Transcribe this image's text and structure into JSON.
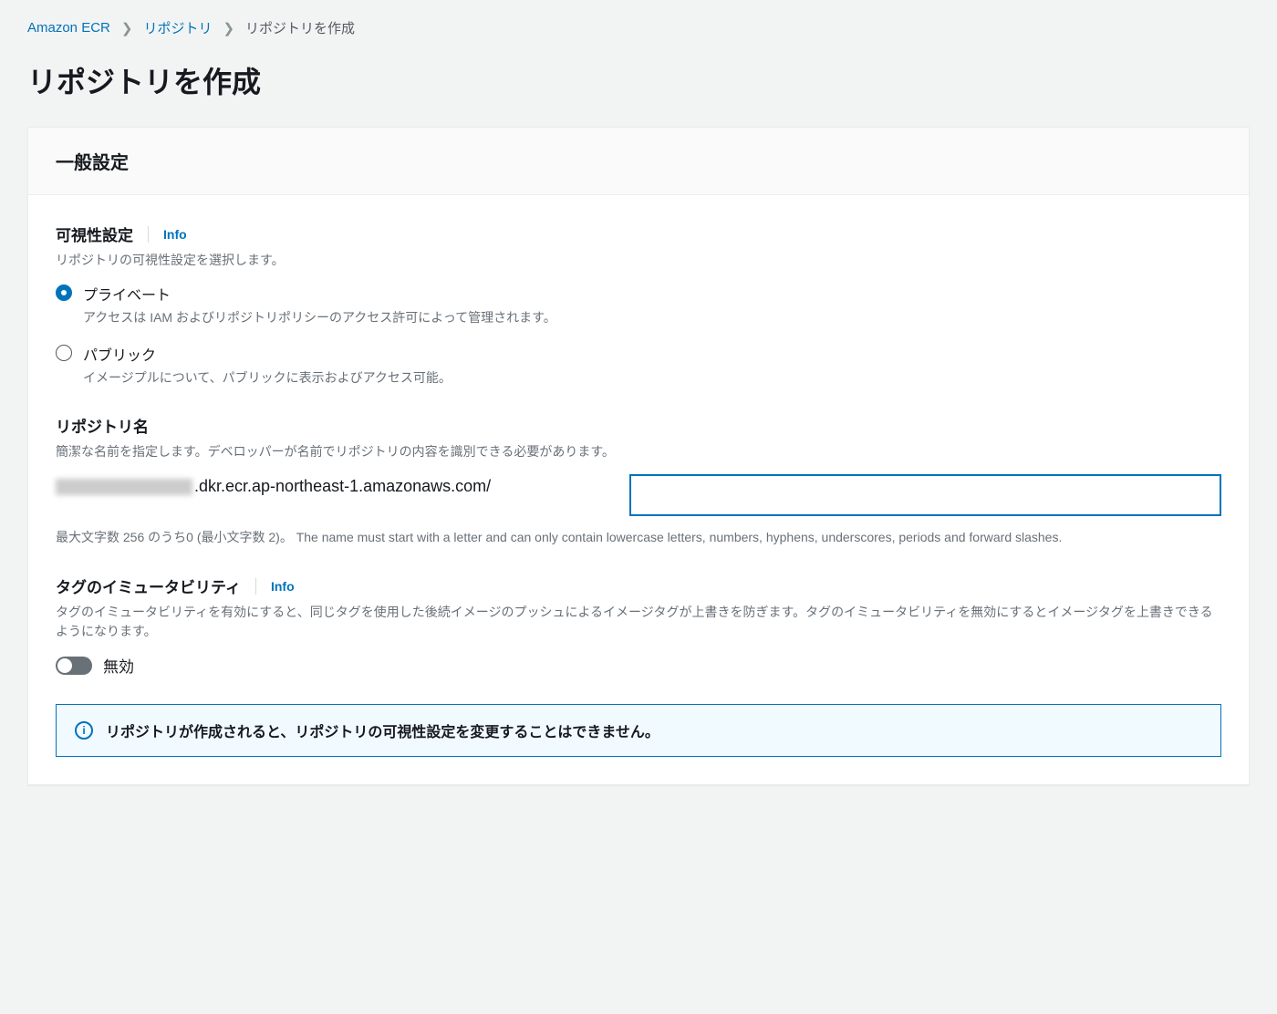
{
  "breadcrumb": {
    "items": [
      {
        "label": "Amazon ECR",
        "link": true
      },
      {
        "label": "リポジトリ",
        "link": true
      },
      {
        "label": "リポジトリを作成",
        "link": false
      }
    ]
  },
  "page_title": "リポジトリを作成",
  "panel": {
    "header": "一般設定",
    "visibility": {
      "label": "可視性設定",
      "info": "Info",
      "desc": "リポジトリの可視性設定を選択します。",
      "options": [
        {
          "label": "プライベート",
          "desc": "アクセスは IAM およびリポジトリポリシーのアクセス許可によって管理されます。",
          "selected": true
        },
        {
          "label": "パブリック",
          "desc": "イメージプルについて、パブリックに表示およびアクセス可能。",
          "selected": false
        }
      ]
    },
    "repo_name": {
      "label": "リポジトリ名",
      "desc": "簡潔な名前を指定します。デベロッパーが名前でリポジトリの内容を識別できる必要があります。",
      "prefix_suffix": ".dkr.ecr.ap-northeast-1.amazonaws.com/",
      "value": "",
      "help": "最大文字数 256 のうち0 (最小文字数 2)。 The name must start with a letter and can only contain lowercase letters, numbers, hyphens, underscores, periods and forward slashes."
    },
    "immutability": {
      "label": "タグのイミュータビリティ",
      "info": "Info",
      "desc": "タグのイミュータビリティを有効にすると、同じタグを使用した後続イメージのプッシュによるイメージタグが上書きを防ぎます。タグのイミュータビリティを無効にするとイメージタグを上書きできるようになります。",
      "state_label": "無効"
    },
    "alert": {
      "text": "リポジトリが作成されると、リポジトリの可視性設定を変更することはできません。"
    }
  }
}
